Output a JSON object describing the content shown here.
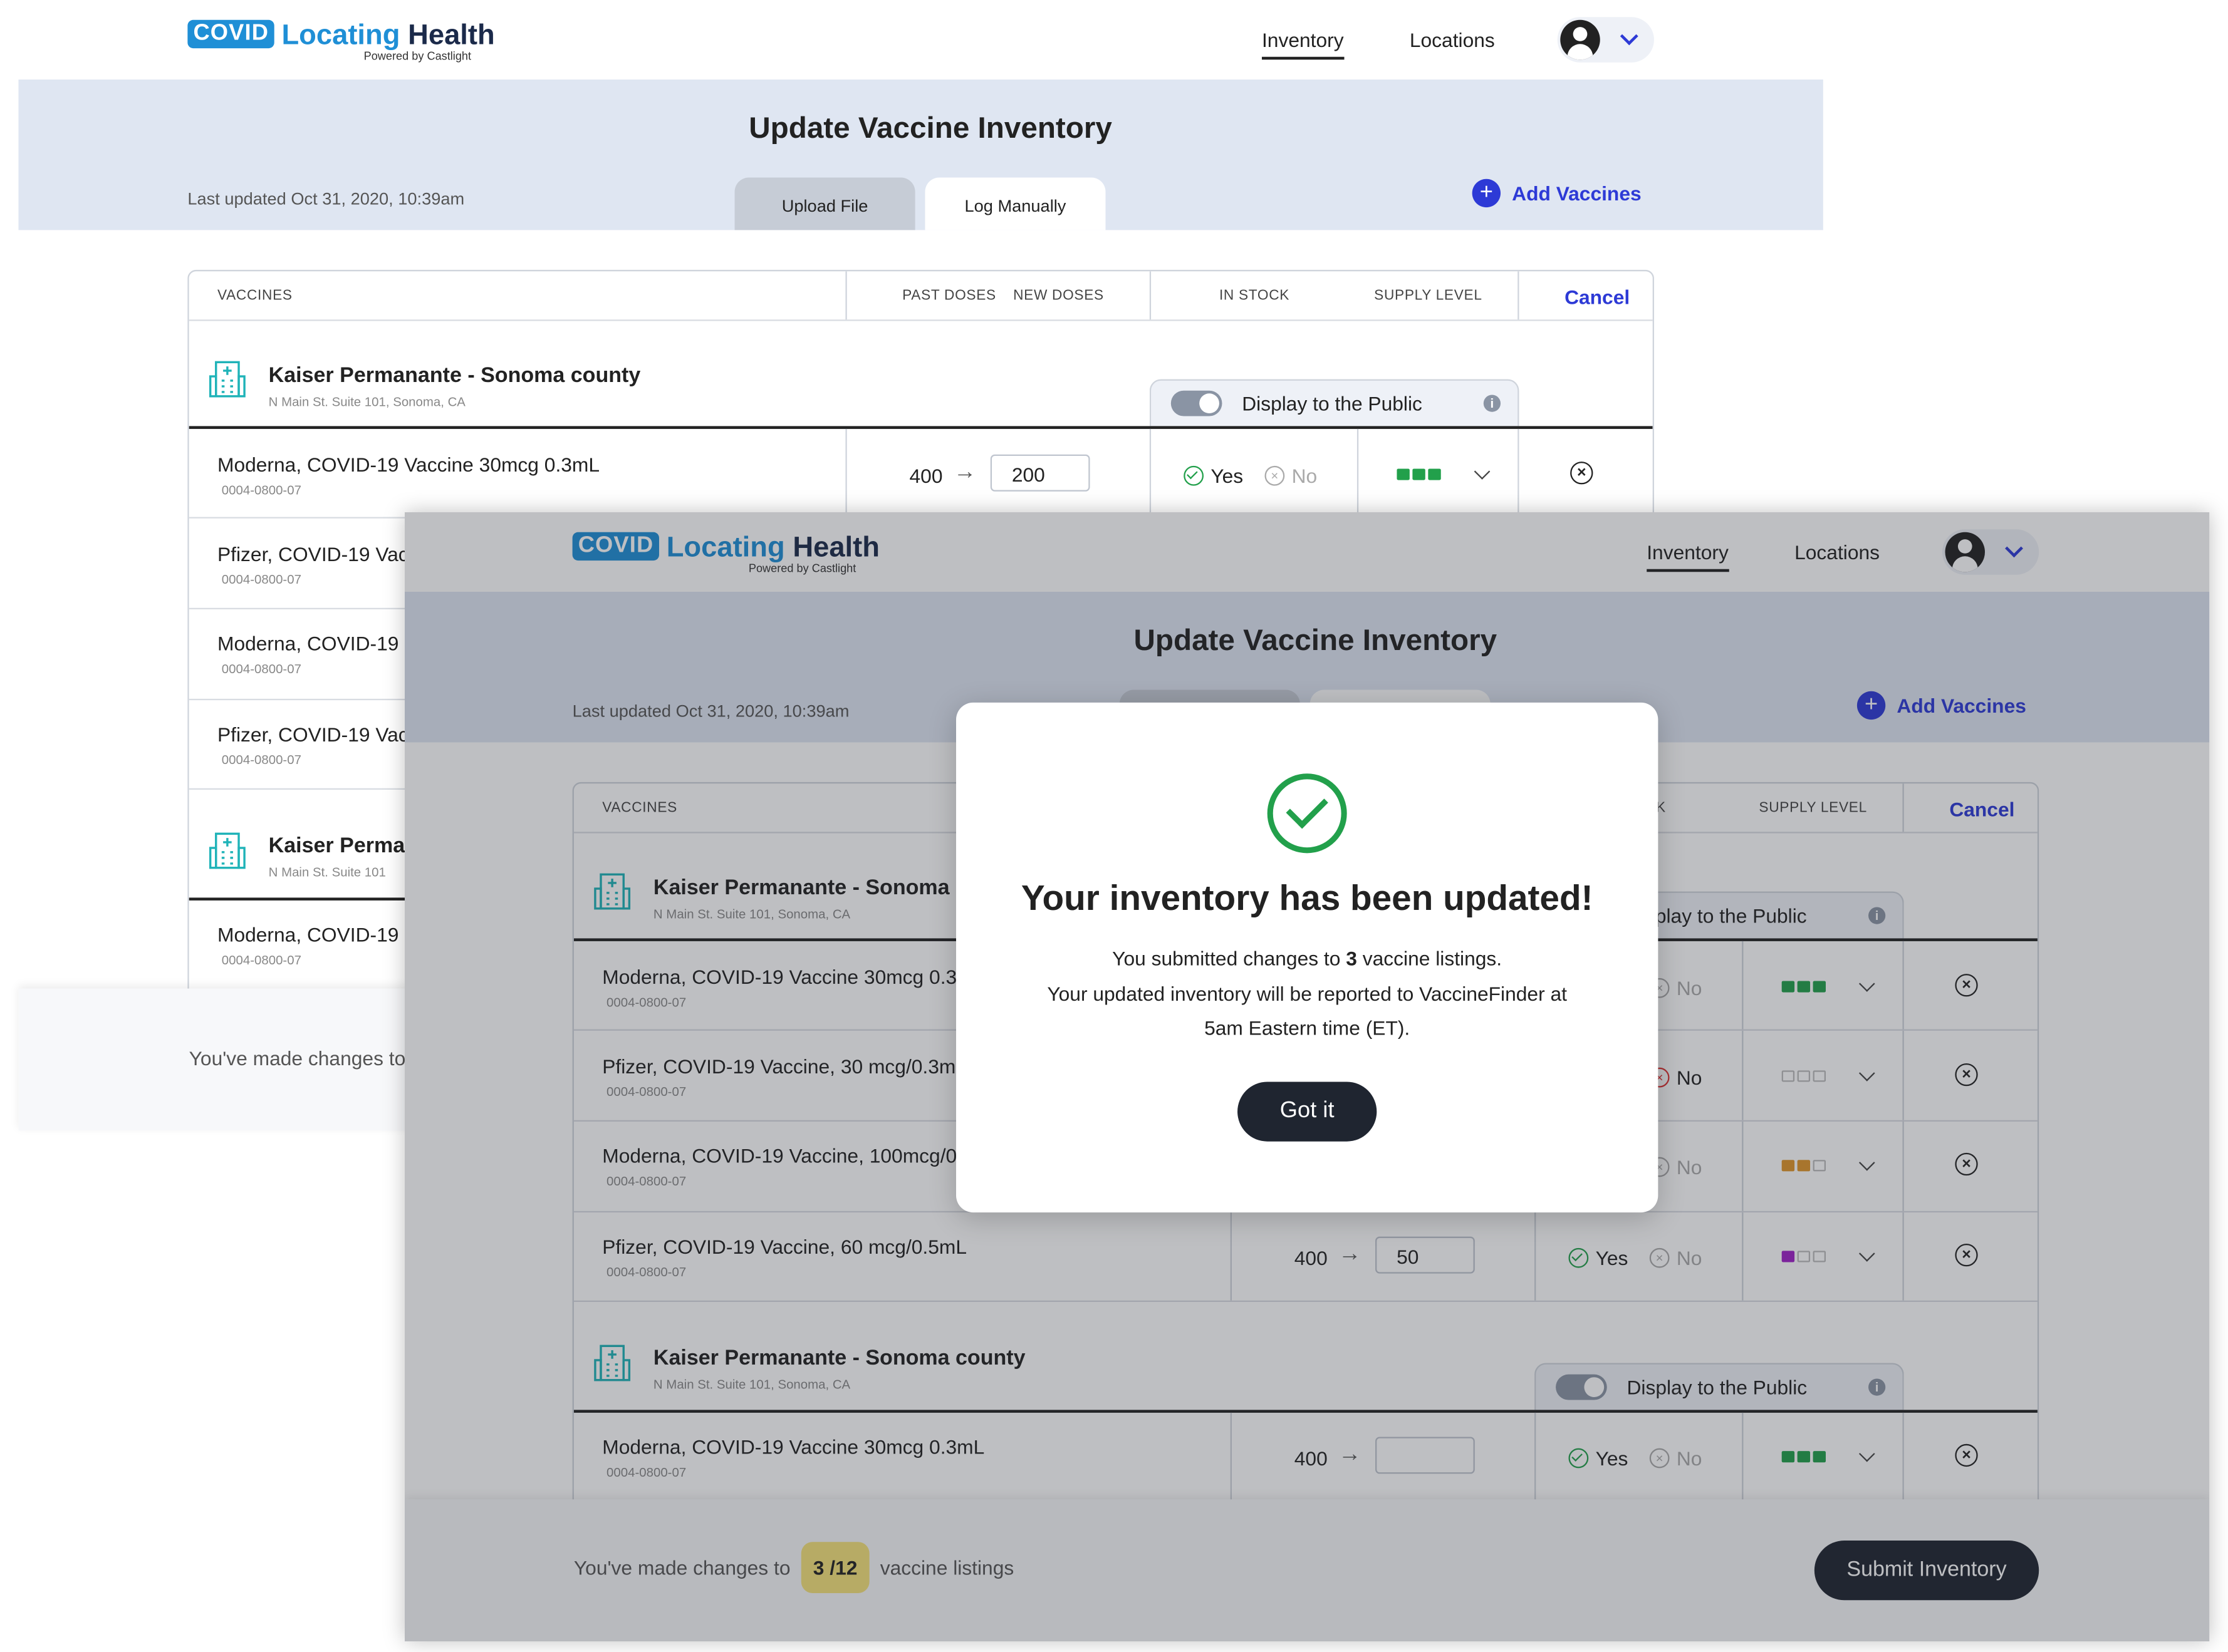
{
  "header": {
    "logo_covid": "COVID",
    "logo_locating": "Locating",
    "logo_health": "Health",
    "logo_powered": "Powered by Castlight",
    "nav_inventory": "Inventory",
    "nav_locations": "Locations"
  },
  "page": {
    "title": "Update Vaccine Inventory",
    "last_updated": "Last updated Oct 31, 2020, 10:39am",
    "tab_upload": "Upload File",
    "tab_manual": "Log Manually",
    "add_vaccines": "Add Vaccines",
    "add_icon": "+"
  },
  "table": {
    "col_vaccines": "VACCINES",
    "col_past": "PAST DOSES",
    "col_new": "NEW DOSES",
    "col_in_stock": "IN STOCK",
    "col_in_stock_partial": "CK",
    "col_supply": "SUPPLY LEVEL",
    "cancel": "Cancel",
    "display_public": "Display to the Public",
    "display_public_partial": "play to the Public",
    "info_icon": "i",
    "yes": "Yes",
    "no": "No",
    "arrow": "→",
    "remove_icon": "×"
  },
  "groups": [
    {
      "title": "Kaiser Permanante - Sonoma county",
      "address": "N Main St. Suite 101, Sonoma, CA"
    },
    {
      "title": "Kaiser Permanante - Sonoma county",
      "address": "N Main St. Suite 101, Sonoma, CA"
    }
  ],
  "back": {
    "group_title_partial": "Kaiser Permar",
    "group_addr_partial": "N Main St. Suite 101",
    "rows": [
      {
        "name": "Moderna, COVID-19 Vaccine 30mcg 0.3mL",
        "code": "0004-0800-07",
        "past": "400",
        "new": "200"
      },
      {
        "name": "Pfizer, COVID-19 Vac",
        "code": "0004-0800-07"
      },
      {
        "name": "Moderna, COVID-19",
        "code": "0004-0800-07"
      },
      {
        "name": "Pfizer, COVID-19 Vac",
        "code": "0004-0800-07"
      },
      {
        "name": "Moderna, COVID-19",
        "code": "0004-0800-07"
      }
    ],
    "footer_text": "You've made changes to"
  },
  "front": {
    "rows": [
      {
        "name": "Moderna, COVID-19 Vaccine 30mcg 0.3",
        "code": "0004-0800-07"
      },
      {
        "name": "Pfizer, COVID-19 Vaccine, 30 mcg/0.3m",
        "code": "0004-0800-07"
      },
      {
        "name": "Moderna, COVID-19 Vaccine, 100mcg/0",
        "code": "0004-0800-07"
      },
      {
        "name": "Pfizer, COVID-19 Vaccine, 60 mcg/0.5mL",
        "code": "0004-0800-07",
        "past": "400",
        "new": "50"
      },
      {
        "name": "Moderna, COVID-19 Vaccine 30mcg 0.3mL",
        "code": "0004-0800-07",
        "past": "400",
        "new": ""
      }
    ],
    "group1_title_partial": "Kaiser Permanante - Sonoma c",
    "footer_prefix": "You've made changes to",
    "footer_count": "3 /12",
    "footer_suffix": "vaccine listings",
    "submit": "Submit Inventory"
  },
  "modal": {
    "title": "Your inventory has been updated!",
    "line1_prefix": "You submitted changes to ",
    "line1_count": "3",
    "line1_suffix": " vaccine listings.",
    "line2": "Your updated inventory will be reported to VaccineFinder at",
    "line3": "5am Eastern time (ET).",
    "button": "Got it"
  },
  "colors": {
    "accent": "#2d3ad6",
    "brand": "#1f8fd6",
    "success": "#22a04b",
    "supply_full": "#22a04b",
    "supply_mid": "#e0952a",
    "supply_low": "#a020c8",
    "badge": "#f5e27a"
  },
  "icons": [
    "hospital-icon",
    "check-circle-icon",
    "x-circle-icon",
    "chevron-down-icon",
    "info-icon",
    "plus-icon",
    "user-avatar-icon"
  ]
}
